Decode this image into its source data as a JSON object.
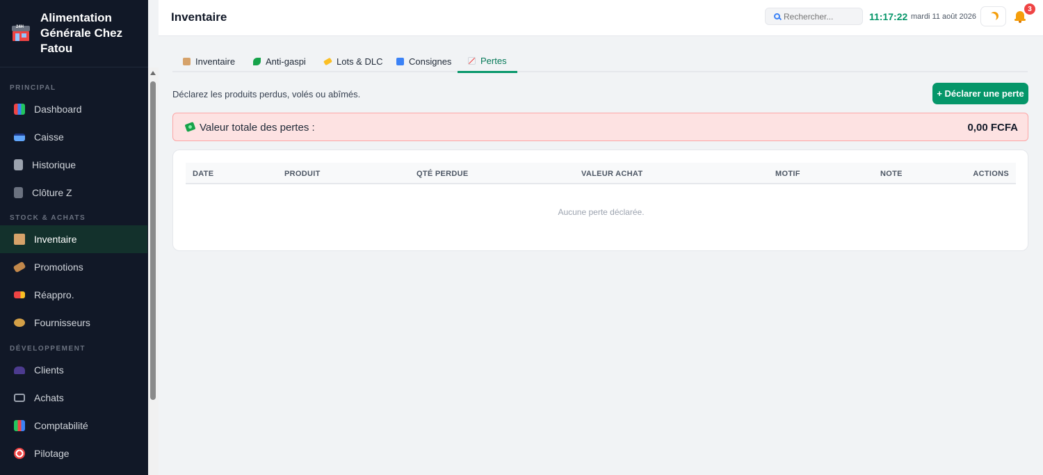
{
  "brand": {
    "name": "Alimentation Générale Chez Fatou",
    "icon": "store-24h-icon"
  },
  "sidebar": {
    "sections": [
      {
        "title": "PRINCIPAL",
        "items": [
          {
            "label": "Dashboard",
            "icon": "bar-chart-icon"
          },
          {
            "label": "Caisse",
            "icon": "credit-card-icon"
          },
          {
            "label": "Historique",
            "icon": "ledger-icon"
          },
          {
            "label": "Clôture Z",
            "icon": "book-icon"
          }
        ]
      },
      {
        "title": "STOCK & ACHATS",
        "items": [
          {
            "label": "Inventaire",
            "icon": "package-icon",
            "active": true
          },
          {
            "label": "Promotions",
            "icon": "tag-icon"
          },
          {
            "label": "Réappro.",
            "icon": "truck-icon"
          },
          {
            "label": "Fournisseurs",
            "icon": "handshake-icon"
          }
        ]
      },
      {
        "title": "DÉVELOPPEMENT",
        "items": [
          {
            "label": "Clients",
            "icon": "users-icon"
          },
          {
            "label": "Achats",
            "icon": "cart-icon"
          },
          {
            "label": "Comptabilité",
            "icon": "books-icon"
          },
          {
            "label": "Pilotage",
            "icon": "target-icon"
          }
        ]
      }
    ]
  },
  "topbar": {
    "title": "Inventaire",
    "search_placeholder": "Rechercher...",
    "clock": "11:17:22",
    "date": "mardi 11 août 2026",
    "notifications": "3"
  },
  "tabs": [
    {
      "label": "Inventaire",
      "icon": "package-icon"
    },
    {
      "label": "Anti-gaspi",
      "icon": "leaf-icon"
    },
    {
      "label": "Lots & DLC",
      "icon": "label-icon"
    },
    {
      "label": "Consignes",
      "icon": "repeat-icon"
    },
    {
      "label": "Pertes",
      "icon": "chart-down-icon",
      "active": true
    }
  ],
  "main": {
    "subtitle": "Déclarez les produits perdus, volés ou abîmés.",
    "declare_button": "+ Déclarer une perte",
    "loss_label": "Valeur totale des pertes :",
    "loss_value": "0,00 FCFA",
    "columns": [
      "DATE",
      "PRODUIT",
      "QTÉ PERDUE",
      "VALEUR ACHAT",
      "MOTIF",
      "NOTE",
      "ACTIONS"
    ],
    "empty_message": "Aucune perte déclarée."
  },
  "colors": {
    "accent": "#059669",
    "sidebar_bg": "#111827",
    "loss_bg": "#fde2e2",
    "badge": "#ef4444"
  }
}
